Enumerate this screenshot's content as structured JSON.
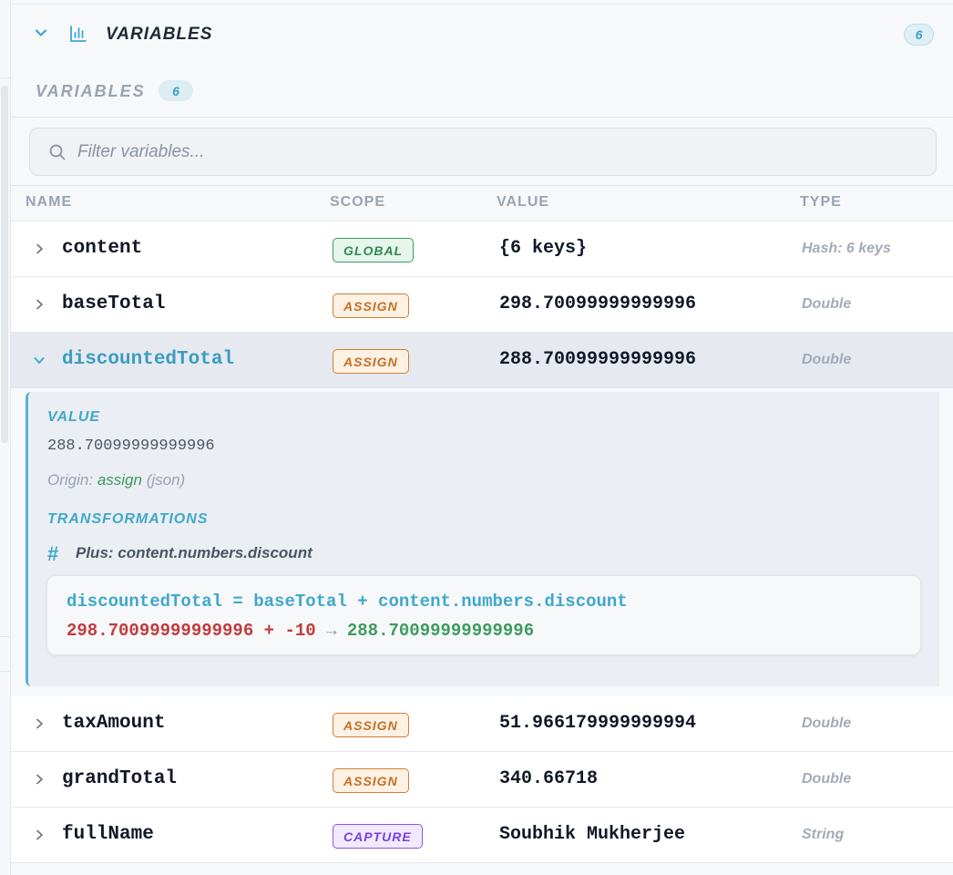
{
  "header": {
    "title": "VARIABLES",
    "count": "6",
    "icon": "bar-chart-icon"
  },
  "section": {
    "label": "VARIABLES",
    "count": "6"
  },
  "filter": {
    "placeholder": "Filter variables...",
    "value": ""
  },
  "columns": [
    "NAME",
    "SCOPE",
    "VALUE",
    "TYPE"
  ],
  "rows": [
    {
      "name": "content",
      "scope": "GLOBAL",
      "value": "{6 keys}",
      "type": "Hash: 6 keys"
    },
    {
      "name": "baseTotal",
      "scope": "ASSIGN",
      "value": "298.70099999999996",
      "type": "Double"
    },
    {
      "name": "discountedTotal",
      "scope": "ASSIGN",
      "value": "288.70099999999996",
      "type": "Double"
    },
    {
      "name": "taxAmount",
      "scope": "ASSIGN",
      "value": "51.966179999999994",
      "type": "Double"
    },
    {
      "name": "grandTotal",
      "scope": "ASSIGN",
      "value": "340.66718",
      "type": "Double"
    },
    {
      "name": "fullName",
      "scope": "CAPTURE",
      "value": "Soubhik Mukherjee",
      "type": "String"
    }
  ],
  "detail": {
    "value_label": "VALUE",
    "value": "288.70099999999996",
    "origin_prefix": "Origin:",
    "origin_kind": "assign",
    "origin_source": "(json)",
    "transformations_label": "TRANSFORMATIONS",
    "transform_title": "Plus: content.numbers.discount",
    "formula": "discountedTotal = baseTotal + content.numbers.discount",
    "eval_left": "298.70099999999996 + -10",
    "eval_arrow": "→",
    "eval_result": "288.70099999999996"
  },
  "colors": {
    "accent": "#3fa8cc",
    "global": "#2f8a51",
    "assign": "#c46f22",
    "capture": "#7b3fe0",
    "error_red": "#c23b3b"
  }
}
